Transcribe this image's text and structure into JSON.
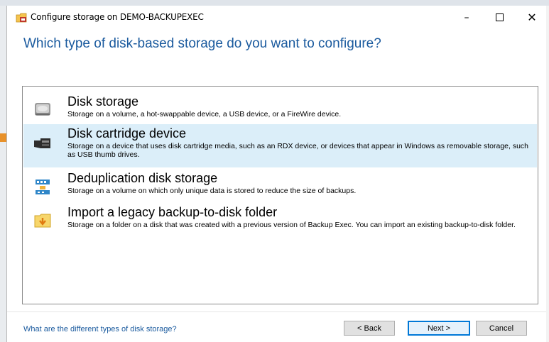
{
  "window": {
    "title": "Configure storage on DEMO-BACKUPEXEC",
    "minimize": "–",
    "close": "✕"
  },
  "heading": "Which type of disk-based storage do you want to configure?",
  "options": [
    {
      "title": "Disk storage",
      "description": "Storage on a volume, a hot-swappable device, a USB device, or a FireWire device.",
      "icon": "hard-disk-icon",
      "selected": false
    },
    {
      "title": "Disk cartridge device",
      "description": "Storage on a device that uses disk cartridge media, such as an RDX device, or devices that appear in Windows as removable storage, such as USB thumb drives.",
      "icon": "disk-cartridge-icon",
      "selected": true
    },
    {
      "title": "Deduplication disk storage",
      "description": "Storage on a volume on which only unique data is stored to reduce the size of backups.",
      "icon": "deduplication-icon",
      "selected": false
    },
    {
      "title": "Import a legacy backup-to-disk folder",
      "description": "Storage on a folder on a disk that was created with a previous version of Backup Exec.  You can import an existing backup-to-disk folder.",
      "icon": "import-folder-icon",
      "selected": false
    }
  ],
  "footer": {
    "help_link": "What are the different types of disk storage?",
    "back": "< Back",
    "next": "Next >",
    "cancel": "Cancel"
  },
  "colors": {
    "heading": "#1a5a9e",
    "selection": "#dbeef9",
    "arrow": "#e8912a"
  }
}
